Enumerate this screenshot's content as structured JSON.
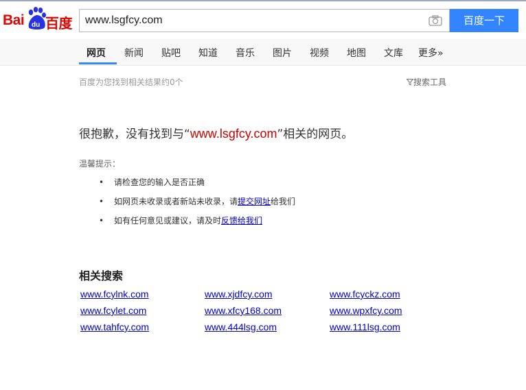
{
  "logo": {
    "part1": "Bai",
    "part2": "百度",
    "paw_text": "du"
  },
  "search": {
    "value": "www.lsgfcy.com",
    "button_label": "百度一下"
  },
  "nav": {
    "items": [
      {
        "label": "网页",
        "active": true
      },
      {
        "label": "新闻"
      },
      {
        "label": "贴吧"
      },
      {
        "label": "知道"
      },
      {
        "label": "音乐"
      },
      {
        "label": "图片"
      },
      {
        "label": "视频"
      },
      {
        "label": "地图"
      },
      {
        "label": "文库"
      },
      {
        "label": "更多»"
      }
    ]
  },
  "result_meta": {
    "count_text": "百度为您找到相关结果约0个",
    "tools_label": "搜索工具"
  },
  "noresult": {
    "prefix": "很抱歉，没有找到与“",
    "keyword": "www.lsgfcy.com",
    "suffix": "”相关的网页。",
    "tips_label": "温馨提示：",
    "tips": [
      {
        "text": "请检查您的输入是否正确"
      },
      {
        "before": "如网页未收录或者新站未收录，请",
        "link": "提交网址",
        "after": "给我们"
      },
      {
        "before": "如有任何意见或建议，请及时",
        "link": "反馈给我们",
        "after": ""
      }
    ]
  },
  "related": {
    "title": "相关搜索",
    "links": [
      "www.fcylnk.com",
      "www.xjdfcy.com",
      "www.fcyckz.com",
      "www.fcylet.com",
      "www.xfcy168.com",
      "www.wpxfcy.com",
      "www.tahfcy.com",
      "www.444lsg.com",
      "www.111lsg.com"
    ]
  },
  "colors": {
    "brand_red": "#e10602",
    "brand_blue": "#3385ff",
    "link": "#0000cc",
    "keyword": "#cc0000"
  }
}
